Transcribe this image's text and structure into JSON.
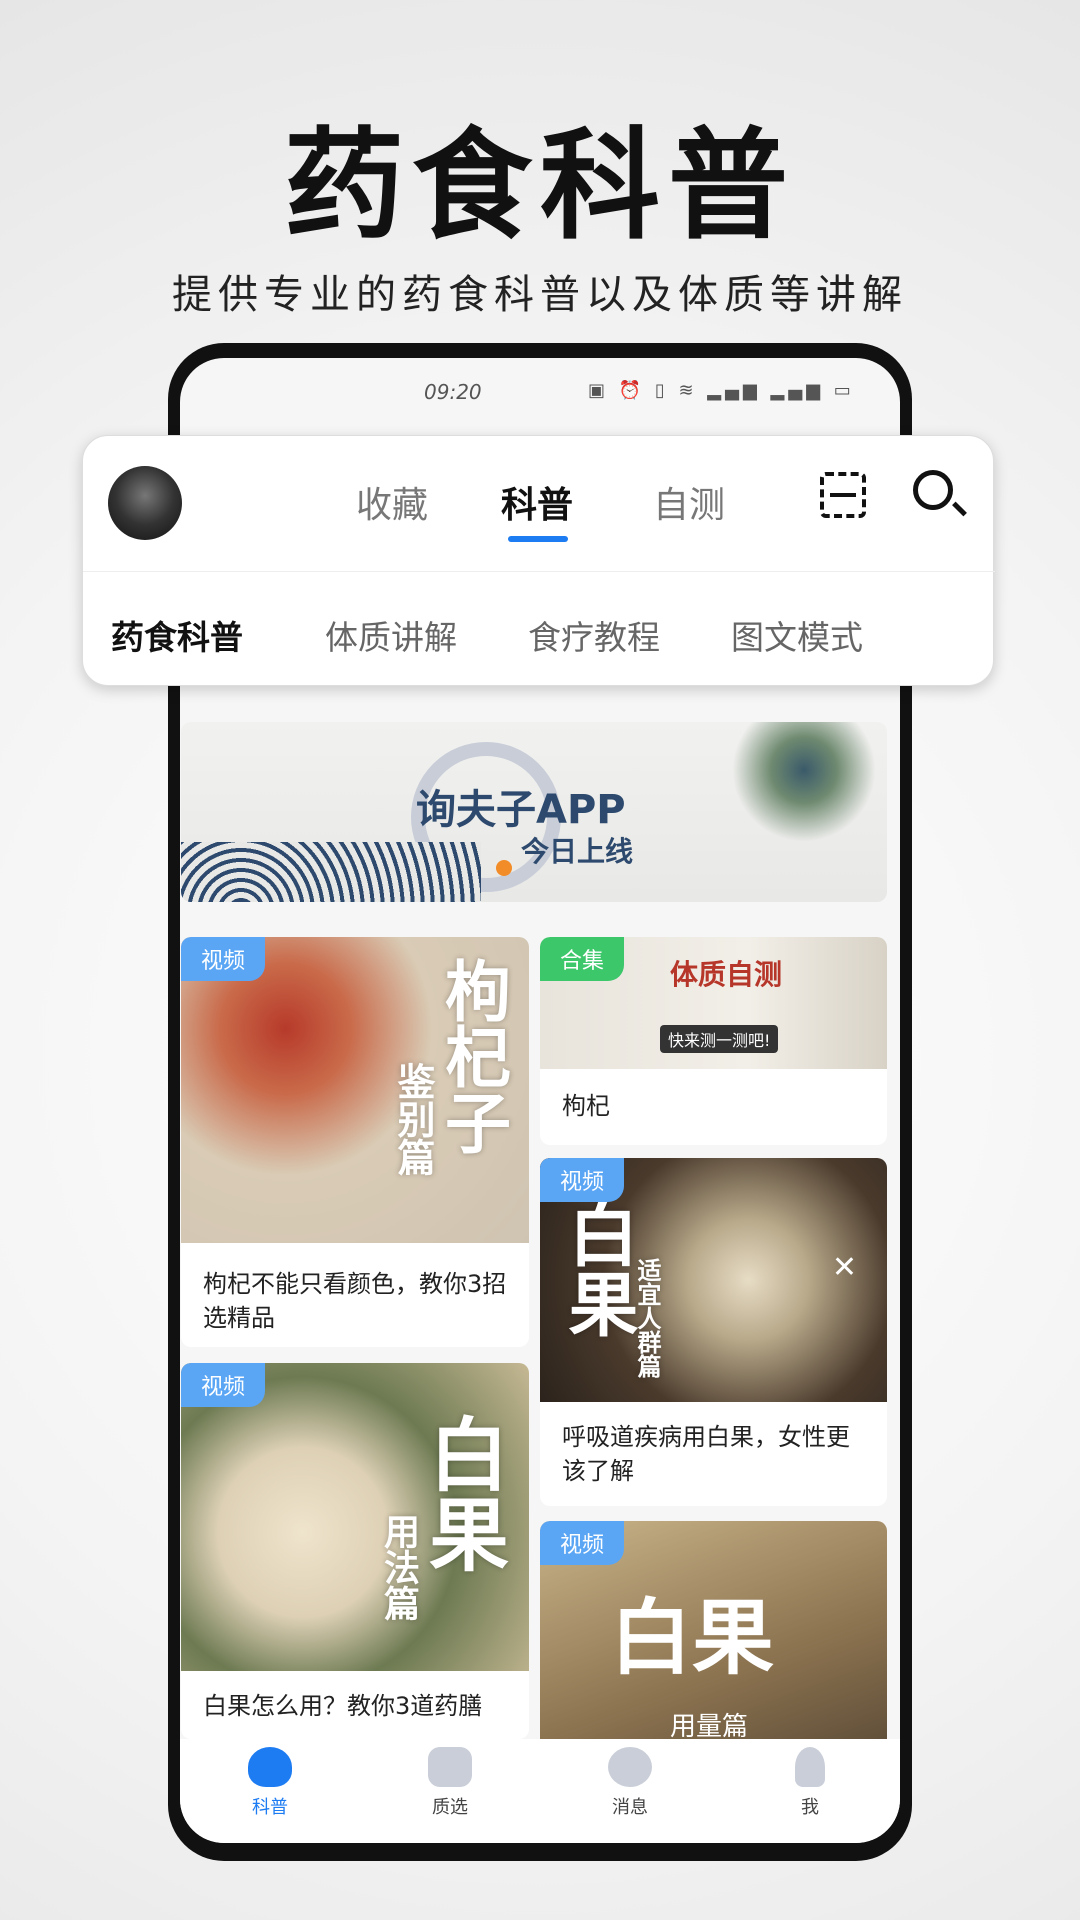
{
  "promo": {
    "title": "药食科普",
    "subtitle": "提供专业的药食科普以及体质等讲解"
  },
  "status_bar": {
    "time": "09:20",
    "icons": "▣ ⏰ ▯ ≋ ▂▄▆ ▂▄▆ ▭"
  },
  "header": {
    "tabs": [
      {
        "label": "收藏"
      },
      {
        "label": "科普",
        "active": true
      },
      {
        "label": "自测"
      }
    ],
    "scan_icon": "scan-icon",
    "search_icon": "search-icon",
    "accent": "#1e7cf2"
  },
  "subtabs": [
    {
      "label": "药食科普",
      "active": true
    },
    {
      "label": "体质讲解"
    },
    {
      "label": "食疗教程"
    },
    {
      "label": "图文模式"
    }
  ],
  "banner": {
    "title": "询夫子APP",
    "subtitle": "今日上线"
  },
  "cards": [
    {
      "badge": "视频",
      "badge_color": "#5aa6f5",
      "image_text": "枸杞子",
      "image_sub": "鉴别篇",
      "caption": "枸杞不能只看颜色，教你3招选精品"
    },
    {
      "badge": "视频",
      "badge_color": "#5aa6f5",
      "image_text": "白果",
      "image_sub": "用法篇",
      "caption": "白果怎么用？教你3道药膳"
    },
    {
      "badge": "合集",
      "badge_color": "#3cc76a",
      "image_text": "体质自测",
      "image_sub": "快来测一测吧!",
      "caption": "枸杞"
    },
    {
      "badge": "视频",
      "badge_color": "#5aa6f5",
      "image_text": "白果",
      "image_sub": "适宜人群篇",
      "caption": "呼吸道疾病用白果，女性更该了解"
    },
    {
      "badge": "视频",
      "badge_color": "#5aa6f5",
      "image_text": "白果",
      "image_sub": "用量篇",
      "caption": ""
    }
  ],
  "bottom_nav": [
    {
      "label": "科普",
      "active": true
    },
    {
      "label": "质选"
    },
    {
      "label": "消息"
    },
    {
      "label": "我"
    }
  ]
}
